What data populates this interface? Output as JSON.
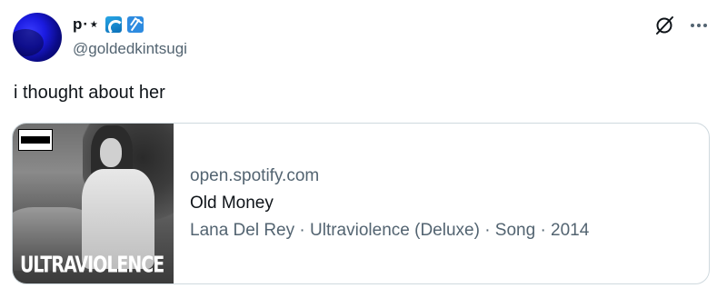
{
  "tweet": {
    "display_name": "p·⋆",
    "handle": "@goldedkintsugi",
    "text": "i thought about her"
  },
  "icons": {
    "name_emojis": [
      "water-wave-icon",
      "sheaf-icon"
    ],
    "header_actions": [
      "grok-icon",
      "more-icon"
    ]
  },
  "card": {
    "domain": "open.spotify.com",
    "title": "Old Money",
    "description": "Lana Del Rey · Ultraviolence (Deluxe) · Song · 2014",
    "album_art_text": "ULTRAVIOLENCE"
  },
  "colors": {
    "text_primary": "#0f1419",
    "text_secondary": "#536471",
    "card_border": "#cfd9de"
  }
}
